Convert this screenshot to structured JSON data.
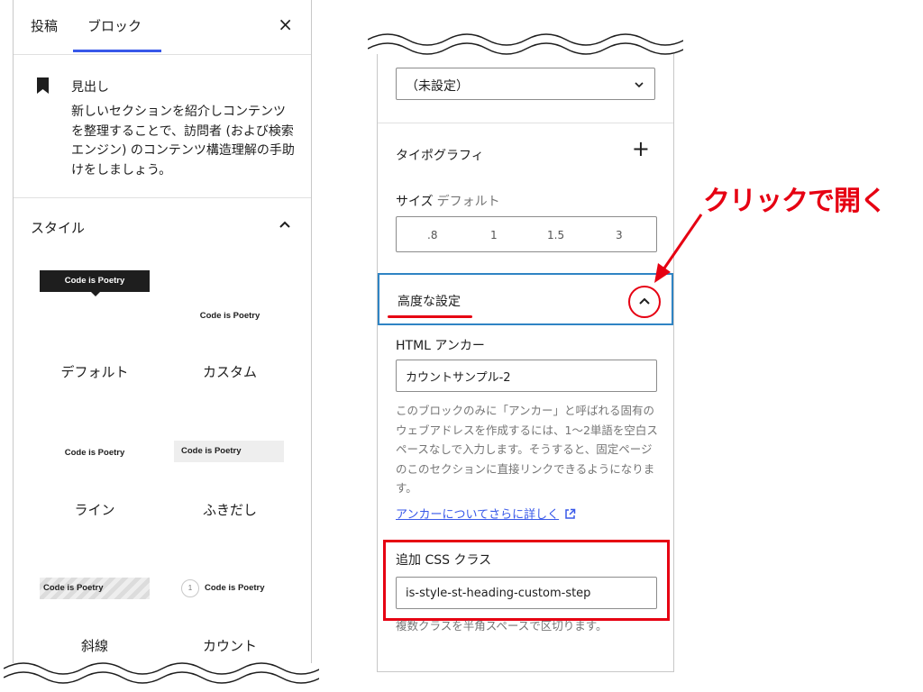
{
  "left_panel": {
    "tabs": [
      {
        "label": "投稿"
      },
      {
        "label": "ブロック"
      }
    ],
    "close_label": "×",
    "block": {
      "title": "見出し",
      "description": "新しいセクションを紹介しコンテンツを整理することで、訪問者 (および検索エンジン) のコンテンツ構造理解の手助けをしましょう。"
    },
    "styles": {
      "title": "スタイル",
      "preview_text": "Code is Poetry",
      "count_number": "1",
      "items": [
        {
          "label": "デフォルト"
        },
        {
          "label": "カスタム"
        },
        {
          "label": "ライン"
        },
        {
          "label": "ふきだし"
        },
        {
          "label": "斜線"
        },
        {
          "label": "カウント"
        }
      ]
    }
  },
  "right_panel": {
    "select_value": "（未設定）",
    "typography": {
      "title": "タイポグラフィ",
      "plus_label": "+",
      "size_label": "サイズ",
      "size_default": "デフォルト",
      "size_options": [
        ".8",
        "1",
        "1.5",
        "3"
      ]
    },
    "advanced": {
      "title": "高度な設定",
      "anchor_label": "HTML アンカー",
      "anchor_value": "カウントサンプル-2",
      "anchor_help": "このブロックのみに「アンカー」と呼ばれる固有のウェブアドレスを作成するには、1〜2単語を空白スペースなしで入力します。そうすると、固定ページのこのセクションに直接リンクできるようになります。",
      "learn_more": "アンカーについてさらに詳しく",
      "css_label": "追加 CSS クラス",
      "css_value": "is-style-st-heading-custom-step",
      "css_help": "複数クラスを半角スペースで区切ります。"
    }
  },
  "annotation": {
    "callout": "クリックで開く"
  },
  "colors": {
    "accent_blue": "#3858e9",
    "highlight_red": "#e60012",
    "focus_blue": "#2f84c4"
  }
}
